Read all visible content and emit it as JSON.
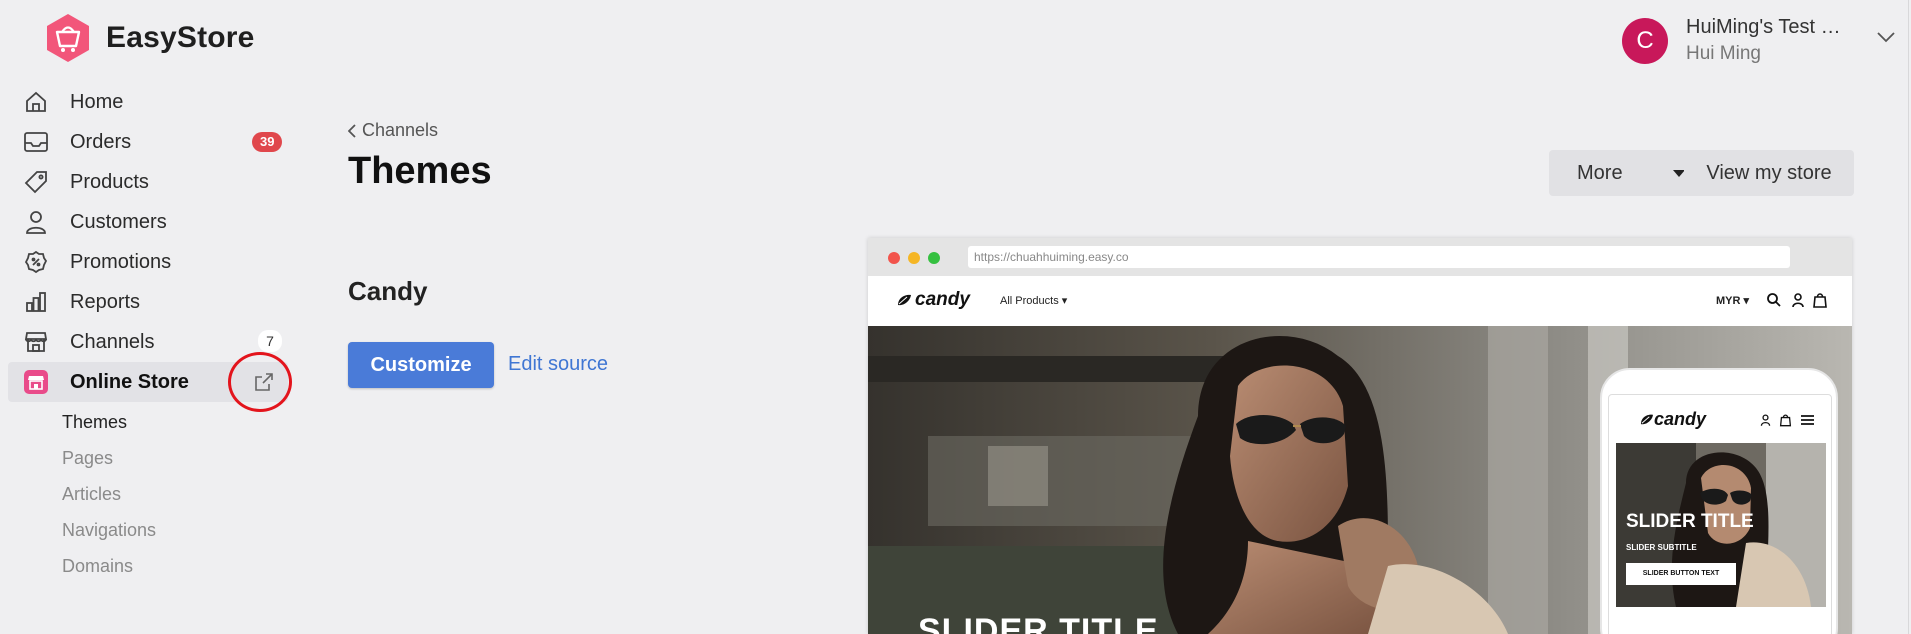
{
  "app": {
    "name": "EasyStore",
    "brand_color": "#f04d72"
  },
  "sidebar": {
    "items": [
      {
        "label": "Home",
        "icon": "home-icon"
      },
      {
        "label": "Orders",
        "icon": "inbox-icon",
        "badge": "39"
      },
      {
        "label": "Products",
        "icon": "tag-icon"
      },
      {
        "label": "Customers",
        "icon": "user-icon"
      },
      {
        "label": "Promotions",
        "icon": "promotion-badge-icon"
      },
      {
        "label": "Reports",
        "icon": "bar-chart-icon"
      },
      {
        "label": "Channels",
        "icon": "storefront-icon",
        "badge": "7"
      },
      {
        "label": "Online Store",
        "icon": "online-store-icon",
        "active": true
      }
    ],
    "subitems": [
      {
        "label": "Themes",
        "active": true
      },
      {
        "label": "Pages"
      },
      {
        "label": "Articles"
      },
      {
        "label": "Navigations"
      },
      {
        "label": "Domains"
      }
    ]
  },
  "account": {
    "avatar_letter": "C",
    "store": "HuiMing's Test Store",
    "user": "Hui Ming",
    "avatar_color": "#c8185a"
  },
  "main": {
    "breadcrumb": "Channels",
    "title": "Themes",
    "more_label": "More",
    "view_store_label": "View my store",
    "theme_name": "Candy",
    "customize_label": "Customize",
    "edit_source_label": "Edit source"
  },
  "preview": {
    "url": "https://chuahhuiming.easy.co",
    "shop_brand": "candy",
    "all_products": "All Products",
    "currency": "MYR",
    "hero_title": "SLIDER TITLE",
    "mobile": {
      "brand": "candy",
      "title": "SLIDER TITLE",
      "subtitle": "SLIDER SUBTITLE",
      "button": "SLIDER BUTTON TEXT"
    }
  }
}
